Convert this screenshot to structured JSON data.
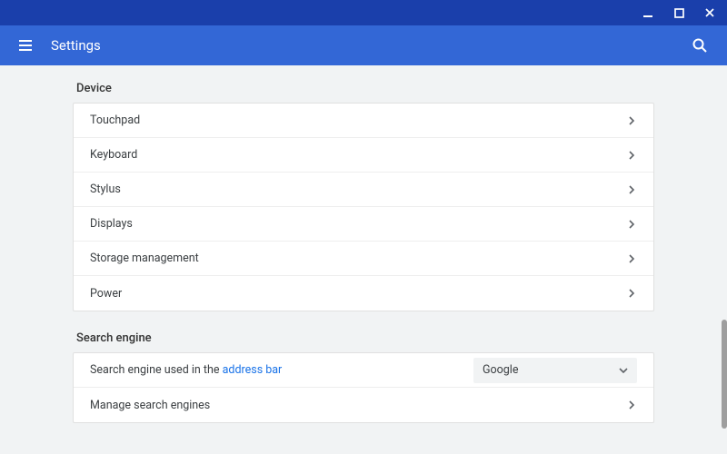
{
  "window": {
    "minimize_icon": "minimize",
    "maximize_icon": "maximize",
    "close_icon": "close"
  },
  "header": {
    "menu_icon": "menu",
    "title": "Settings",
    "search_icon": "search"
  },
  "sections": {
    "device": {
      "title": "Device",
      "items": [
        {
          "label": "Touchpad"
        },
        {
          "label": "Keyboard"
        },
        {
          "label": "Stylus"
        },
        {
          "label": "Displays"
        },
        {
          "label": "Storage management"
        },
        {
          "label": "Power"
        }
      ]
    },
    "search_engine": {
      "title": "Search engine",
      "row_label_prefix": "Search engine used in the ",
      "row_label_link": "address bar",
      "select_value": "Google",
      "manage_label": "Manage search engines"
    }
  }
}
